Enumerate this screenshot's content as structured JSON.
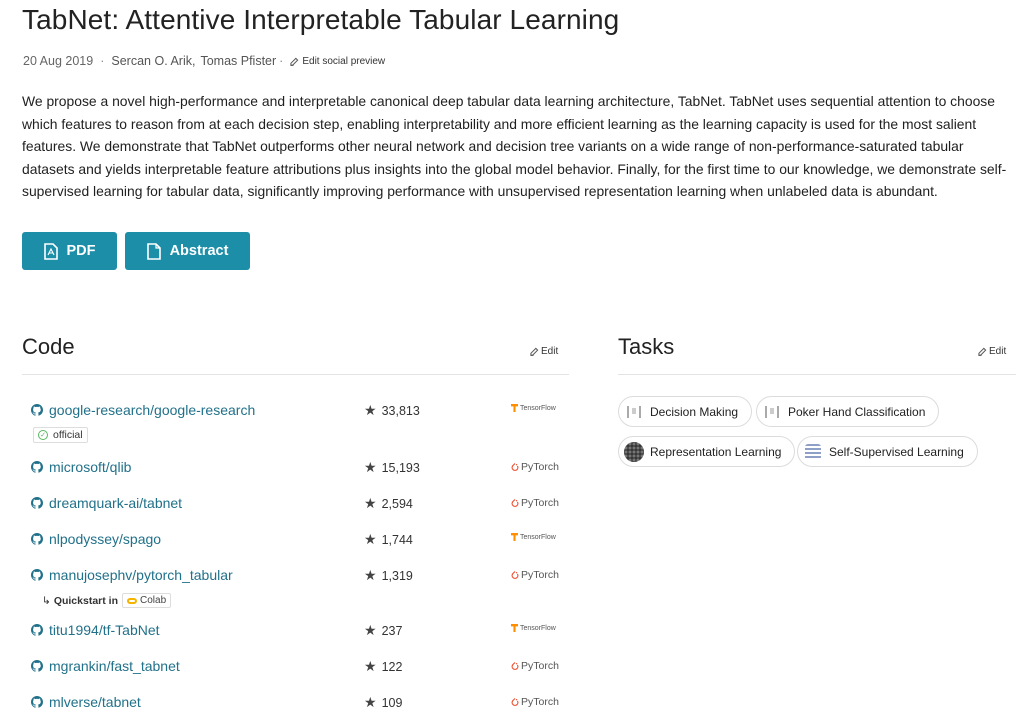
{
  "paper": {
    "title": "TabNet: Attentive Interpretable Tabular Learning",
    "date": "20 Aug 2019",
    "authors": [
      "Sercan O. Arik,",
      "Tomas Pfister"
    ],
    "edit_social": "Edit social preview",
    "abstract": "We propose a novel high-performance and interpretable canonical deep tabular data learning architecture, TabNet. TabNet uses sequential attention to choose which features to reason from at each decision step, enabling interpretability and more efficient learning as the learning capacity is used for the most salient features. We demonstrate that TabNet outperforms other neural network and decision tree variants on a wide range of non-performance-saturated tabular datasets and yields interpretable feature attributions plus insights into the global model behavior. Finally, for the first time to our knowledge, we demonstrate self-supervised learning for tabular data, significantly improving performance with unsupervised representation learning when unlabeled data is abundant."
  },
  "buttons": {
    "pdf": "PDF",
    "abstract": "Abstract"
  },
  "code": {
    "title": "Code",
    "edit": "Edit",
    "repos": [
      {
        "name": "google-research/google-research",
        "stars": "33,813",
        "framework": "TensorFlow",
        "fw_icon": "tensorflow-icon"
      },
      {
        "name": "microsoft/qlib",
        "stars": "15,193",
        "framework": "PyTorch",
        "fw_icon": "pytorch-icon"
      },
      {
        "name": "dreamquark-ai/tabnet",
        "stars": "2,594",
        "framework": "PyTorch",
        "fw_icon": "pytorch-icon"
      },
      {
        "name": "nlpodyssey/spago",
        "stars": "1,744",
        "framework": "TensorFlow",
        "fw_icon": "tensorflow-icon"
      },
      {
        "name": "manujosephv/pytorch_tabular",
        "stars": "1,319",
        "framework": "PyTorch",
        "fw_icon": "pytorch-icon"
      },
      {
        "name": "titu1994/tf-TabNet",
        "stars": "237",
        "framework": "TensorFlow",
        "fw_icon": "tensorflow-icon"
      },
      {
        "name": "mgrankin/fast_tabnet",
        "stars": "122",
        "framework": "PyTorch",
        "fw_icon": "pytorch-icon"
      },
      {
        "name": "mlverse/tabnet",
        "stars": "109",
        "framework": "PyTorch",
        "fw_icon": "pytorch-icon"
      }
    ],
    "official_badge": "official",
    "quickstart_label": "Quickstart in",
    "colab_label": "Colab"
  },
  "tasks": {
    "title": "Tasks",
    "edit": "Edit",
    "items": [
      {
        "label": "Decision Making",
        "icon": "bracket-icon"
      },
      {
        "label": "Poker Hand Classification",
        "icon": "bracket-icon"
      },
      {
        "label": "Representation Learning",
        "icon": "dots-icon"
      },
      {
        "label": "Self-Supervised Learning",
        "icon": "stack-icon"
      }
    ]
  },
  "colors": {
    "accent": "#1d8ea8",
    "link": "#21718a",
    "tensorflow": "#ff8f00",
    "pytorch": "#ee4c2c"
  }
}
